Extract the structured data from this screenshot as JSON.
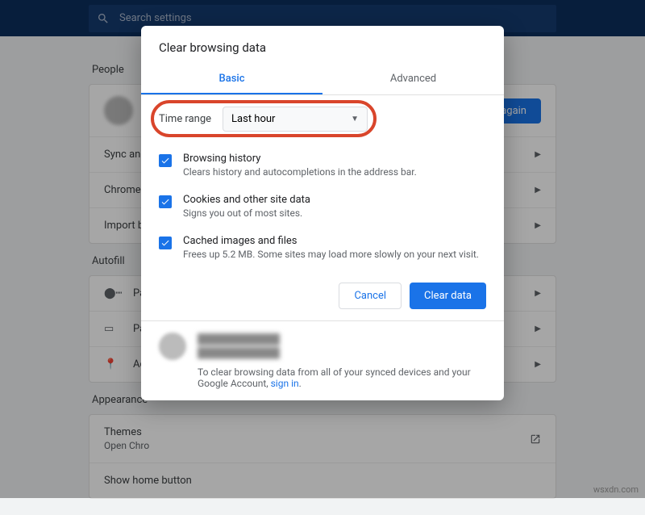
{
  "search": {
    "placeholder": "Search settings"
  },
  "sections": {
    "people": "People",
    "autofill": "Autofill",
    "appearance": "Appearance"
  },
  "people": {
    "sign_in_btn": "n in again",
    "sync": "Sync and C",
    "chrome_name": "Chrome na",
    "import": "Import boo"
  },
  "autofill": {
    "pass": "Pas",
    "pay": "Pay",
    "addr": "Ad"
  },
  "appearance": {
    "themes": "Themes",
    "themes_sub": "Open Chro",
    "show_home": "Show home button"
  },
  "dialog": {
    "title": "Clear browsing data",
    "tab_basic": "Basic",
    "tab_advanced": "Advanced",
    "time_label": "Time range",
    "time_value": "Last hour",
    "items": [
      {
        "title": "Browsing history",
        "desc": "Clears history and autocompletions in the address bar."
      },
      {
        "title": "Cookies and other site data",
        "desc": "Signs you out of most sites."
      },
      {
        "title": "Cached images and files",
        "desc": "Frees up 5.2 MB. Some sites may load more slowly on your next visit."
      }
    ],
    "cancel": "Cancel",
    "clear": "Clear data",
    "footer_text": "To clear browsing data from all of your synced devices and your Google Account, ",
    "footer_link": "sign in",
    "footer_period": "."
  },
  "watermark": "wsxdn.com"
}
